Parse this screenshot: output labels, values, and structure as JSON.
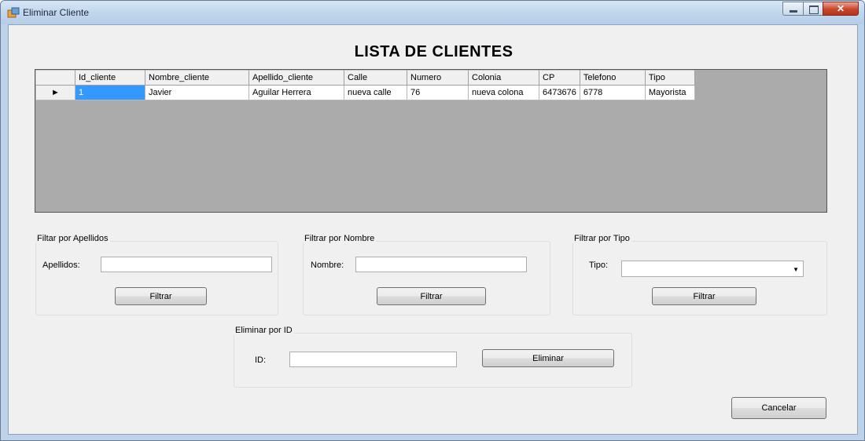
{
  "window": {
    "title": "Eliminar Cliente"
  },
  "heading": "LISTA DE CLIENTES",
  "table": {
    "columns": [
      "Id_cliente",
      "Nombre_cliente",
      "Apellido_cliente",
      "Calle",
      "Numero",
      "Colonia",
      "CP",
      "Telefono",
      "Tipo"
    ],
    "rows": [
      [
        "1",
        "Javier",
        "Aguilar Herrera",
        "nueva calle",
        "76",
        "nueva colona",
        "6473676",
        "6778",
        "Mayorista"
      ]
    ]
  },
  "filter_apellidos": {
    "legend": "Filtar por Apellidos",
    "label": "Apellidos:",
    "value": "",
    "button": "Filtrar"
  },
  "filter_nombre": {
    "legend": "Filtrar por Nombre",
    "label": "Nombre:",
    "value": "",
    "button": "Filtrar"
  },
  "filter_tipo": {
    "legend": "Filtrar por Tipo",
    "label": "Tipo:",
    "selected": "",
    "button": "Filtrar"
  },
  "eliminar": {
    "legend": "Eliminar por ID",
    "label": "ID:",
    "value": "",
    "button": "Eliminar"
  },
  "cancel_button": "Cancelar",
  "colors": {
    "selection": "#3399ff",
    "grid_background": "#ababab",
    "close_button": "#c8452c"
  }
}
